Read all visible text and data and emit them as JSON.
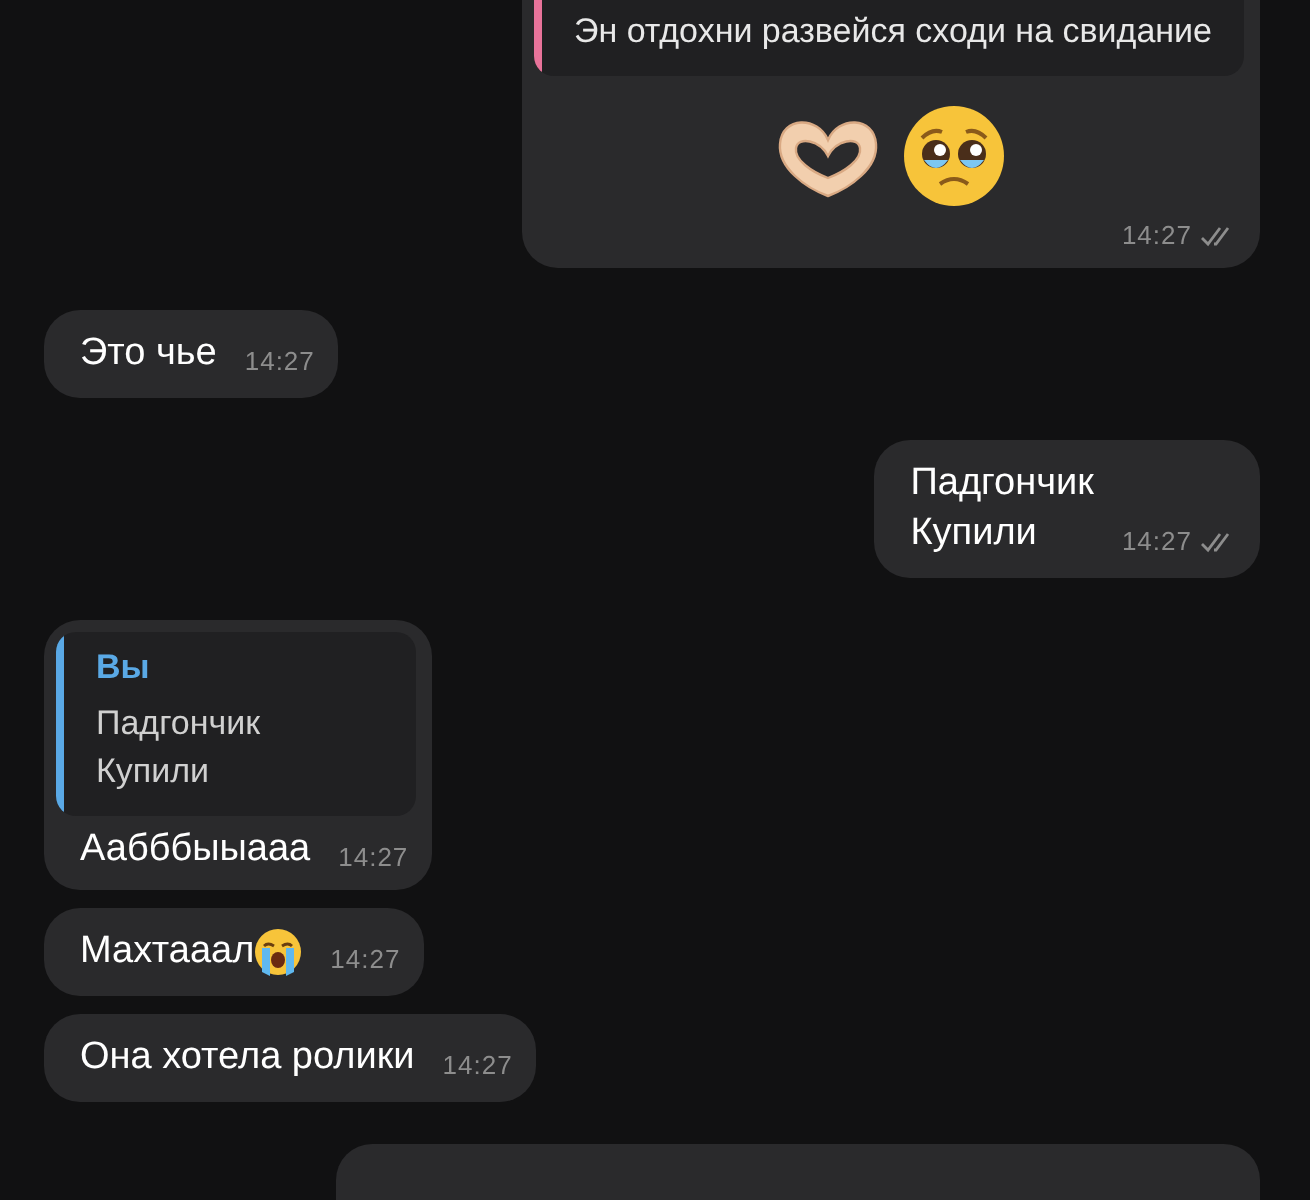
{
  "messages": [
    {
      "kind": "outgoing",
      "reply": {
        "text": "Эн отдохни развейся сходи на свидание",
        "color": "#e8739a"
      },
      "emoji": [
        {
          "kind": "heart-hands"
        },
        {
          "kind": "pleading-face"
        }
      ],
      "time": "14:27",
      "read": true
    },
    {
      "kind": "incoming",
      "text": "Это чье",
      "time": "14:27"
    },
    {
      "kind": "outgoing",
      "text": "Падгончик\nКупили",
      "time": "14:27",
      "read": true
    },
    {
      "kind": "incoming",
      "reply": {
        "author": "Вы",
        "text": "Падгончик\nКупили",
        "color": "#5aa9e6"
      },
      "text": "Аабббыыааа",
      "time": "14:27"
    },
    {
      "kind": "incoming",
      "text": "Махтааал",
      "inline_emoji": [
        {
          "kind": "crying-face"
        }
      ],
      "time": "14:27"
    },
    {
      "kind": "incoming",
      "text": "Она хотела ролики",
      "time": "14:27"
    },
    {
      "kind": "outgoing"
    }
  ]
}
